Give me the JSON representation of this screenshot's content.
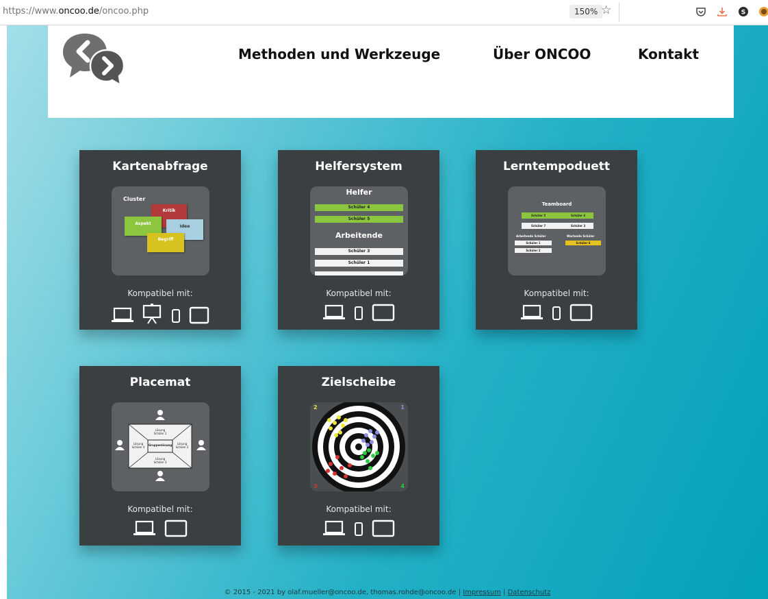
{
  "browser": {
    "url_prefix": "https://www.",
    "url_domain": "oncoo.de",
    "url_path": "/oncoo.php",
    "zoom": "150%"
  },
  "nav": {
    "items": [
      "Methoden und Werkzeuge",
      "Über ONCOO",
      "Kontakt"
    ]
  },
  "cards": [
    {
      "title": "Kartenabfrage",
      "compat": "Kompatibel mit:",
      "devices": [
        "laptop-icon",
        "whiteboard-icon",
        "phone-icon",
        "tablet-icon"
      ],
      "preview": {
        "cluster": "Cluster",
        "cards": [
          "Kritik",
          "Aspekt",
          "Idee",
          "Begriff"
        ]
      }
    },
    {
      "title": "Helfersystem",
      "compat": "Kompatibel mit:",
      "devices": [
        "laptop-icon",
        "phone-icon",
        "tablet-icon"
      ],
      "preview": {
        "helpers_heading": "Helfer",
        "helpers": [
          "Schüler 4",
          "Schüler 5"
        ],
        "workers_heading": "Arbeitende",
        "workers": [
          "Schüler 3",
          "Schüler 1"
        ]
      }
    },
    {
      "title": "Lerntempoduett",
      "compat": "Kompatibel mit:",
      "devices": [
        "laptop-icon",
        "phone-icon",
        "tablet-icon"
      ],
      "preview": {
        "teamboard": "Teamboard",
        "pair1": [
          "Schüler 5",
          "Schüler 4"
        ],
        "pair2": [
          "Schüler 7",
          "Schüler 3"
        ],
        "working_label": "Arbeitende Schüler",
        "waiting_label": "Wartende Schüler",
        "working": [
          "Schüler 1",
          "Schüler 2"
        ],
        "waiting": [
          "Schüler 6"
        ]
      }
    },
    {
      "title": "Placemat",
      "compat": "Kompatibel mit:",
      "devices": [
        "laptop-icon",
        "tablet-icon"
      ],
      "preview": {
        "center": "Gruppenlösung",
        "top": "Lösung Schüler 1",
        "right": "Lösung Schüler 2",
        "bottom": "Lösung Schüler 3",
        "left": "Lösung Schüler 4"
      }
    },
    {
      "title": "Zielscheibe",
      "compat": "Kompatibel mit:",
      "devices": [
        "laptop-icon",
        "phone-icon",
        "tablet-icon"
      ],
      "preview": {
        "corners": [
          "2",
          "1",
          "3",
          "4"
        ]
      }
    }
  ],
  "footer": {
    "text": "© 2015 - 2021 by olaf.mueller@oncoo.de, thomas.rohde@oncoo.de | ",
    "impressum": "Impressum",
    "separator": " | ",
    "datenschutz": "Datenschutz"
  },
  "colors": {
    "card_bg": "#3a4042",
    "green": "#8cc63f",
    "red": "#b33a3a",
    "yellow": "#d8c21f",
    "lightblue": "#a7cfe0",
    "accent_teal": "#05a1bb"
  }
}
